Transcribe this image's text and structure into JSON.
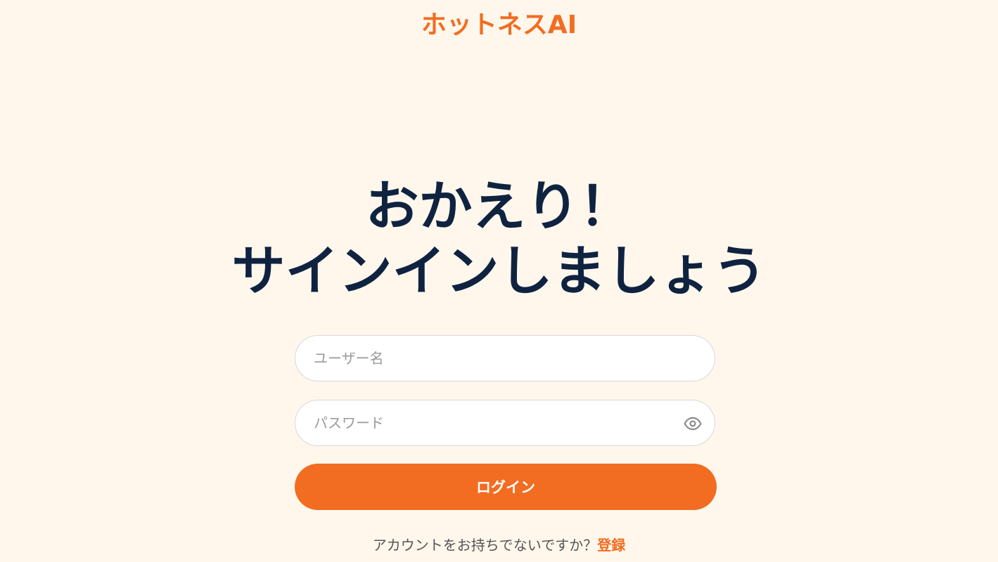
{
  "header": {
    "brand": "ホットネスAI"
  },
  "main": {
    "heading_line1": "おかえり！",
    "heading_line2": "サインインしましょう",
    "username": {
      "placeholder": "ユーザー名",
      "value": ""
    },
    "password": {
      "placeholder": "パスワード",
      "value": "",
      "toggle_icon": "eye-icon"
    },
    "login_label": "ログイン",
    "signup_prompt": "アカウントをお持ちでないですか？",
    "signup_link": "登録"
  },
  "colors": {
    "background": "#fff7ec",
    "accent": "#f26d21",
    "heading": "#0f2340"
  }
}
